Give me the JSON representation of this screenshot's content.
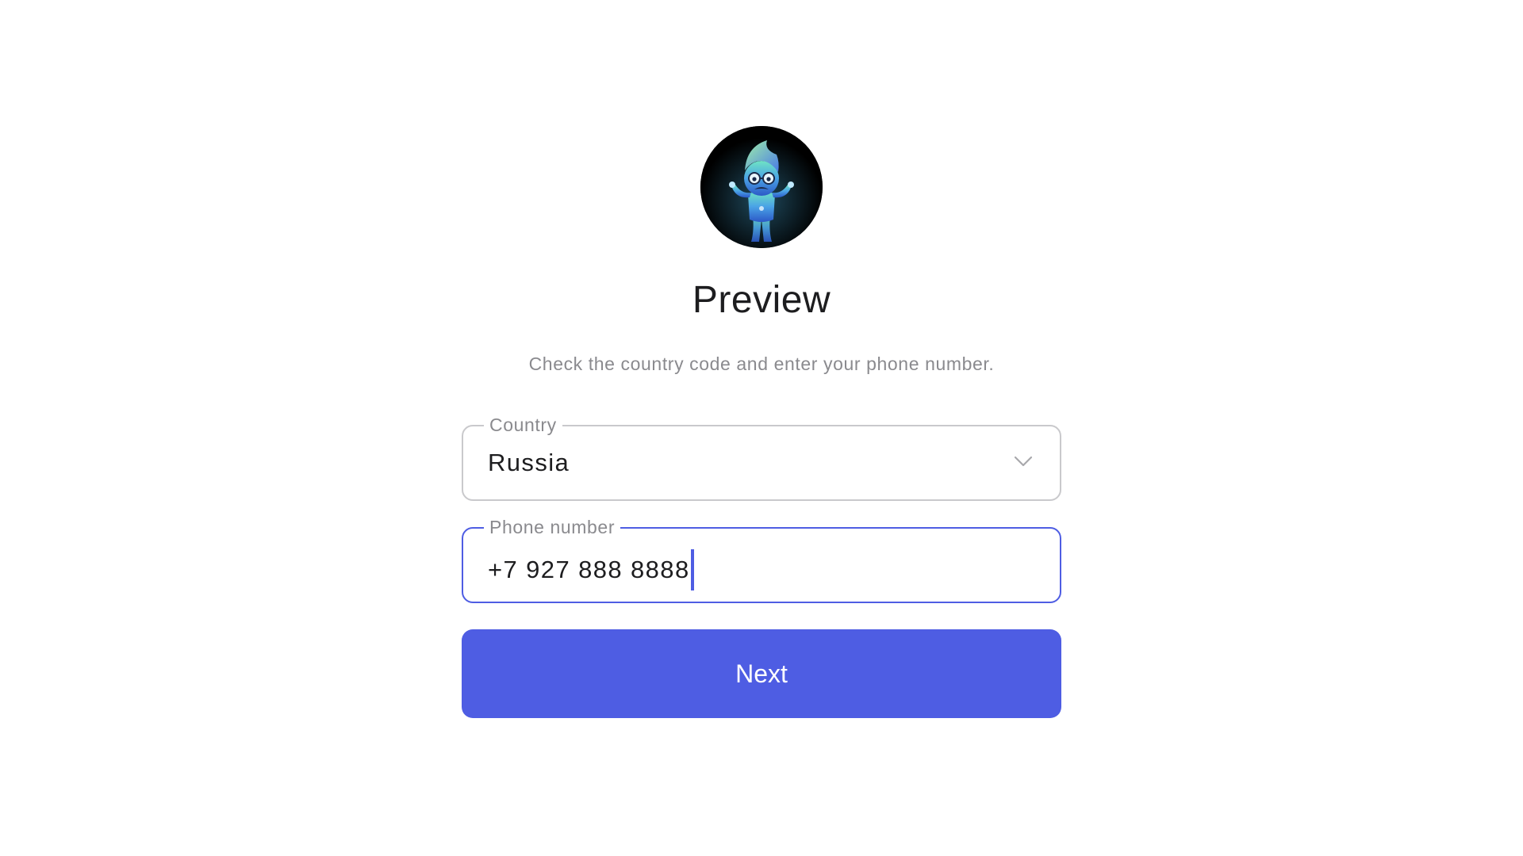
{
  "header": {
    "avatar_icon": "character-avatar-icon",
    "title": "Preview",
    "subtitle": "Check the country code and enter your phone number."
  },
  "form": {
    "country": {
      "label": "Country",
      "value": "Russia",
      "icon": "chevron-down-icon"
    },
    "phone": {
      "label": "Phone number",
      "value": "+7 927 888 8888"
    },
    "next_label": "Next"
  },
  "colors": {
    "accent": "#4e5de3",
    "text": "#1d1d1f",
    "muted": "#8a8a8e",
    "border": "#c9c9cc"
  }
}
